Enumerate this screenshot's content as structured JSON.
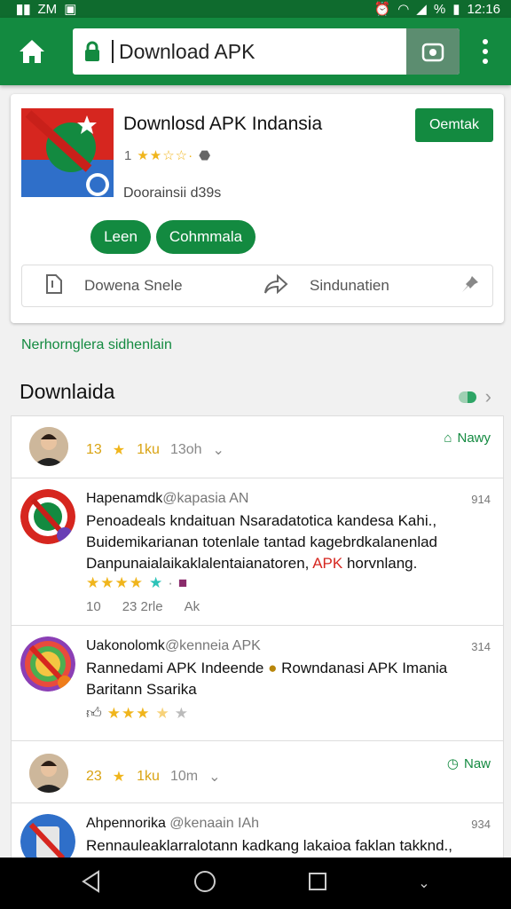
{
  "status": {
    "left": "ZM",
    "time": "12:16",
    "battery": "%"
  },
  "toolbar": {
    "url": "Download APK"
  },
  "app_card": {
    "title": "Downlosd APK Indansia",
    "rating_label": "1",
    "rating_fraction": 0.3,
    "subtitle": "Doorainsii d39s",
    "open_label": "Oemtak",
    "pill1": "Leen",
    "pill2": "Cohmmala",
    "action1": "Dowena Snele",
    "action2": "Sindunatien"
  },
  "section": {
    "link": "Nerhornglera sidhenlain",
    "title": "Downlaida"
  },
  "feed": {
    "summary1": {
      "count": "13",
      "rating": "1ku",
      "time": "13oh",
      "badge": "Nawy"
    },
    "post1": {
      "name": "Hapenamdk",
      "handle": "@kapasia AN",
      "time": "914",
      "text_a": "Penoadeals kndaituan Nsaradatotica kandesa Kahi., Buidemikarianan totenlale tantad kagebrdkalanenlad Danpunaialaikaklalentaianatoren, ",
      "apk": "APK",
      "text_b": " horvnlang.",
      "stars": 0.85,
      "foot1": "10",
      "foot2": "23 2rle",
      "foot3": "Ak"
    },
    "post2": {
      "name": "Uakonolomk",
      "handle": "@kenneia APK",
      "time": "314",
      "text_a": "Rannedami APK Indeende",
      "text_b": "Rowndanasi APK Imania",
      "text_c": "Baritann Ssarika",
      "stars": 0.75
    },
    "summary2": {
      "count": "23",
      "rating": "1ku",
      "time": "10m",
      "badge": "Naw"
    },
    "post3": {
      "name": "Ahpennorika",
      "handle": "@kenaain IAh",
      "time": "934",
      "text": "Rennauleaklarralotann kadkang lakaioa faklan takknd.,"
    }
  },
  "colors": {
    "brand": "#138a40",
    "star": "#f0b51c",
    "accent_red": "#d6261f"
  }
}
